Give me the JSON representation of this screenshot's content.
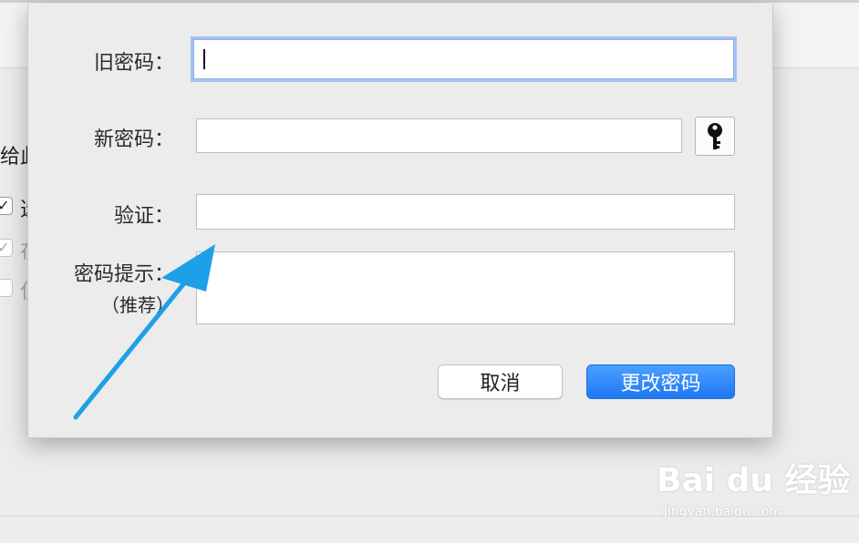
{
  "background": {
    "visible_text": "给此",
    "checks": [
      {
        "mark": "✓",
        "text": "选"
      },
      {
        "mark": "✓",
        "text": "在"
      },
      {
        "mark": "",
        "text": "仅"
      }
    ]
  },
  "dialog": {
    "old_password_label": "旧密码：",
    "new_password_label": "新密码：",
    "verify_label": "验证：",
    "hint_label": "密码提示：",
    "hint_sublabel": "（推荐）",
    "old_password_value": "",
    "new_password_value": "",
    "verify_value": "",
    "hint_value": "",
    "cancel_label": "取消",
    "change_label": "更改密码",
    "key_icon": "key-icon"
  },
  "watermark": {
    "brand": "Bai du 经验",
    "url": "jingyan.baidu.com"
  },
  "colors": {
    "accent_blue": "#1f78f5",
    "arrow_blue": "#1ea0e8",
    "focus_ring": "#a3c1f2"
  }
}
